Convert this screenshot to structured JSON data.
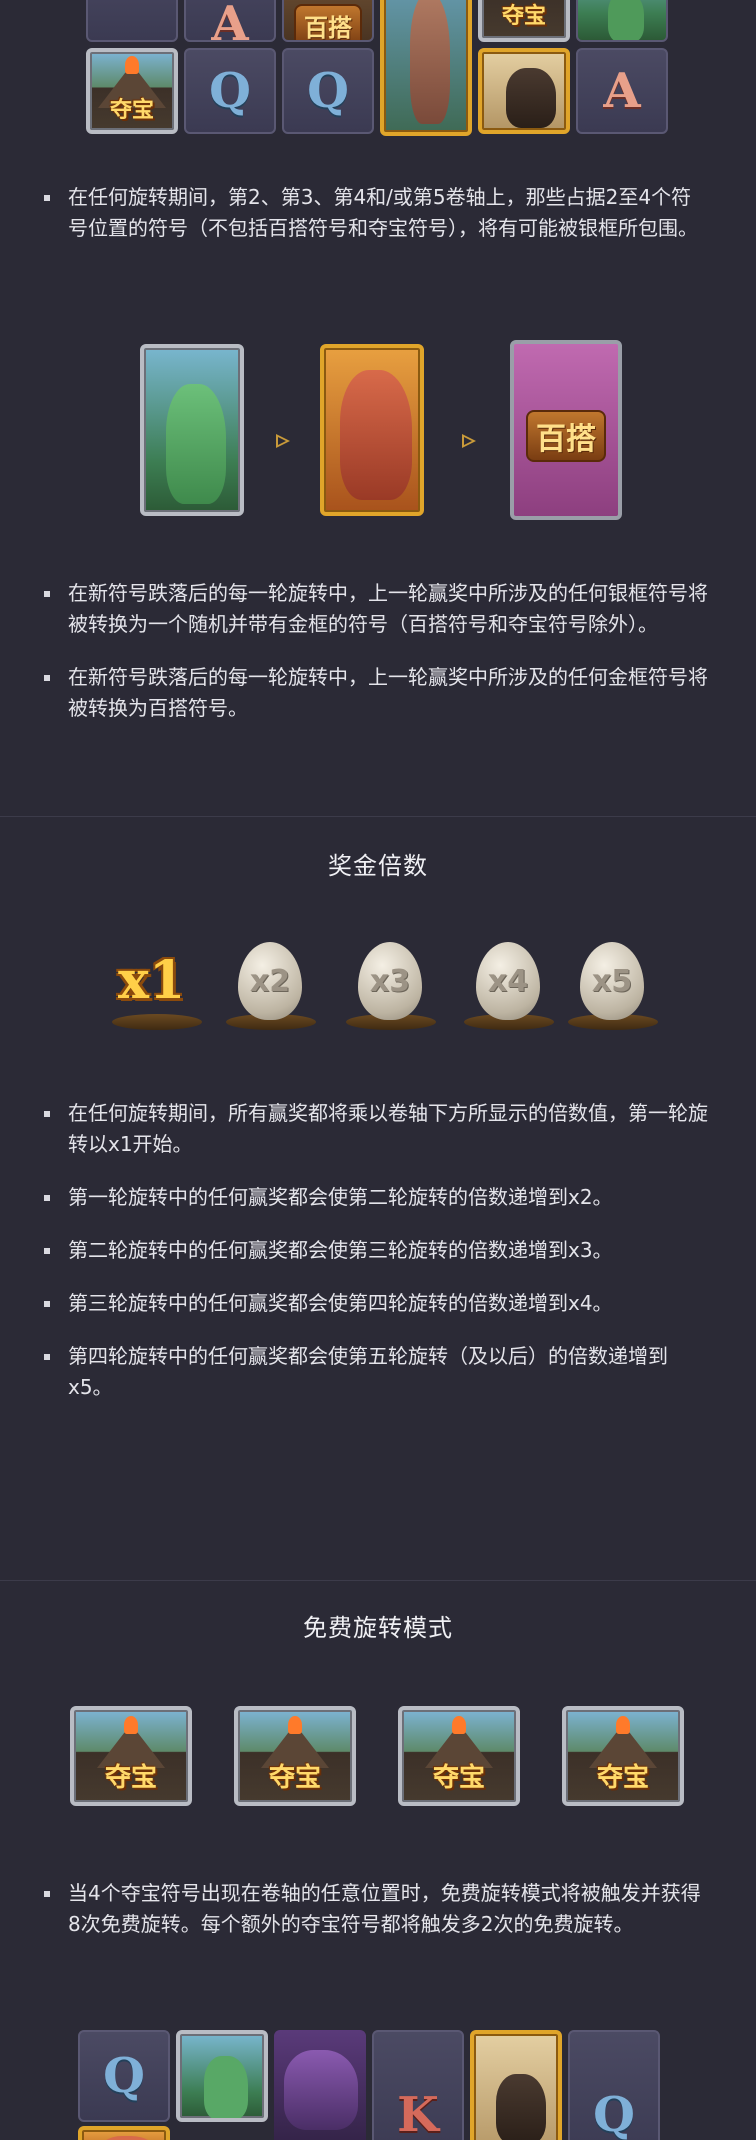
{
  "symbols": {
    "letter_A": "A",
    "letter_Q": "Q",
    "letter_K": "K",
    "wild": "百搭",
    "treasure": "夺宝"
  },
  "section1": {
    "bullets": [
      "在任何旋转期间，第2、第3、第4和/或第5卷轴上，那些占据2至4个符号位置的符号（不包括百搭符号和夺宝符号），将有可能被银框所包围。",
      "在新符号跌落后的每一轮旋转中，上一轮赢奖中所涉及的任何银框符号将被转换为一个随机并带有金框的符号（百搭符号和夺宝符号除外）。",
      "在新符号跌落后的每一轮旋转中，上一轮赢奖中所涉及的任何金框符号将被转换为百搭符号。"
    ]
  },
  "multiplier_section": {
    "title": "奖金倍数",
    "eggs": [
      "x1",
      "x2",
      "x3",
      "x4",
      "x5"
    ],
    "bullets": [
      "在任何旋转期间，所有赢奖都将乘以卷轴下方所显示的倍数值，第一轮旋转以x1开始。",
      "第一轮旋转中的任何赢奖都会使第二轮旋转的倍数递增到x2。",
      "第二轮旋转中的任何赢奖都会使第三轮旋转的倍数递增到x3。",
      "第三轮旋转中的任何赢奖都会使第四轮旋转的倍数递增到x4。",
      "第四轮旋转中的任何赢奖都会使第五轮旋转（及以后）的倍数递增到x5。"
    ]
  },
  "free_spins_section": {
    "title": "免费旋转模式",
    "bullets": [
      "当4个夺宝符号出现在卷轴的任意位置时，免费旋转模式将被触发并获得8次免费旋转。每个额外的夺宝符号都将触发多2次的免费旋转。"
    ]
  }
}
